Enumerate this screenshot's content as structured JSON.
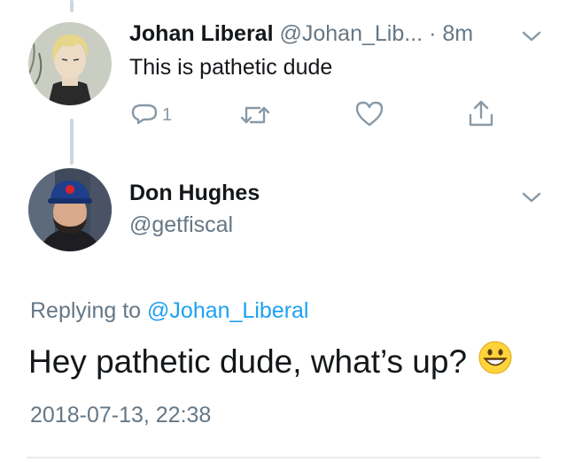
{
  "parent_tweet": {
    "display_name": "Johan Liberal",
    "handle": "@Johan_Lib...",
    "separator": "·",
    "time_ago": "8m",
    "text": "This is pathetic dude",
    "reply_count": "1",
    "avatar_icon": "anime-character-avatar"
  },
  "focus_tweet": {
    "display_name": "Don Hughes",
    "handle": "@getfiscal",
    "avatar_icon": "man-in-cap-avatar",
    "replying_prefix": "Replying to",
    "replying_to": "@Johan_Liberal",
    "text": "Hey pathetic dude, what’s up?",
    "emoji": "grinning-face-emoji",
    "timestamp": "2018-07-13, 22:38"
  },
  "colors": {
    "primary_text": "#14171a",
    "secondary_text": "#657786",
    "icon_gray": "#8899a6",
    "link_blue": "#1da1f2",
    "divider": "#e6ecf0"
  }
}
